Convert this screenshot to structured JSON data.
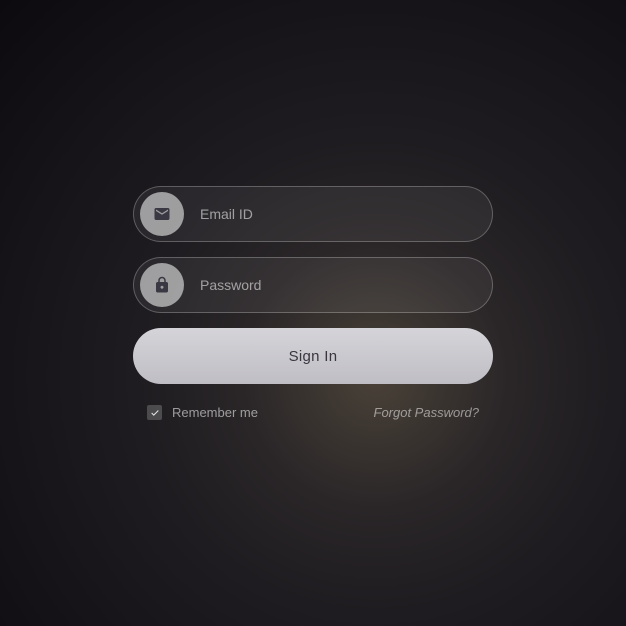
{
  "fields": {
    "email": {
      "placeholder": "Email ID",
      "value": ""
    },
    "password": {
      "placeholder": "Password",
      "value": ""
    }
  },
  "buttons": {
    "signin": "Sign In"
  },
  "options": {
    "remember": {
      "label": "Remember me",
      "checked": true
    },
    "forgot": "Forgot Password?"
  }
}
